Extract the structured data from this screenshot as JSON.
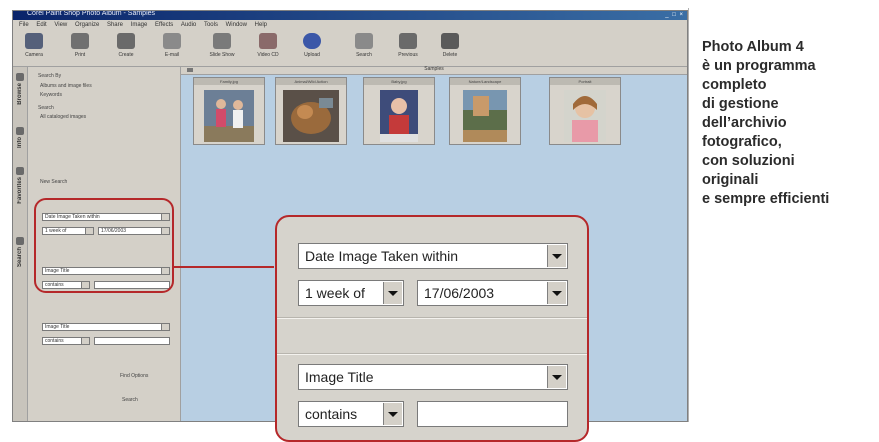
{
  "app": {
    "title": "Corel Paint Shop Photo Album - Samples",
    "window_controls": "_ □ ×"
  },
  "menu": [
    "File",
    "Edit",
    "View",
    "Organize",
    "Share",
    "Image",
    "Effects",
    "Audio",
    "Tools",
    "Window",
    "Help"
  ],
  "toolbar": [
    {
      "label": "Camera",
      "icon": "camera-icon"
    },
    {
      "label": "Print",
      "icon": "print-icon"
    },
    {
      "label": "Create",
      "icon": "create-icon"
    },
    {
      "label": "E-mail",
      "icon": "email-icon"
    },
    {
      "label": "Slide Show",
      "icon": "slideshow-icon"
    },
    {
      "label": "Video CD",
      "icon": "videocd-icon"
    },
    {
      "label": "Upload",
      "icon": "upload-icon"
    },
    {
      "label": "Search",
      "icon": "search-icon"
    },
    {
      "label": "Previous",
      "icon": "previous-icon"
    },
    {
      "label": "Delete",
      "icon": "delete-icon"
    }
  ],
  "side_tabs": [
    "Browse",
    "Info",
    "Favorites",
    "Search"
  ],
  "sidebar": {
    "search_by": "Search By",
    "opt_album": "Albums and image files",
    "opt_keywords": "Keywords",
    "search_label": "Search",
    "check_all": "All cataloged images",
    "new_search": "New Search",
    "row1_sel": "Date Image Taken within",
    "row1_a": "1 week of",
    "row1_b": "17/06/2003",
    "row2_sel": "Image Title",
    "row2_a": "contains",
    "row3_sel": "Image Title",
    "row3_a": "contains",
    "find_options": "Find Options",
    "search_btn": "Search"
  },
  "content": {
    "header": "Samples",
    "thumbnails": [
      {
        "caption": "Family.jpg"
      },
      {
        "caption": "Animal/Wild Action"
      },
      {
        "caption": "Baby.jpg"
      },
      {
        "caption": "Nature/Landscape"
      },
      {
        "caption": "Portrait"
      }
    ]
  },
  "zoom": {
    "field1": "Date Image Taken within",
    "range": "1 week of",
    "date": "17/06/2003",
    "field2": "Image Title",
    "op": "contains",
    "value": ""
  },
  "caption_lines": [
    "Photo Album 4",
    "è un programma",
    "completo",
    "di gestione",
    "dell’archivio",
    "fotografico,",
    "con soluzioni",
    "originali",
    "e sempre efficienti"
  ],
  "colors": {
    "accent": "#b5282a",
    "content_bg": "#b8cfe3",
    "window_bg": "#d4d0c8"
  }
}
